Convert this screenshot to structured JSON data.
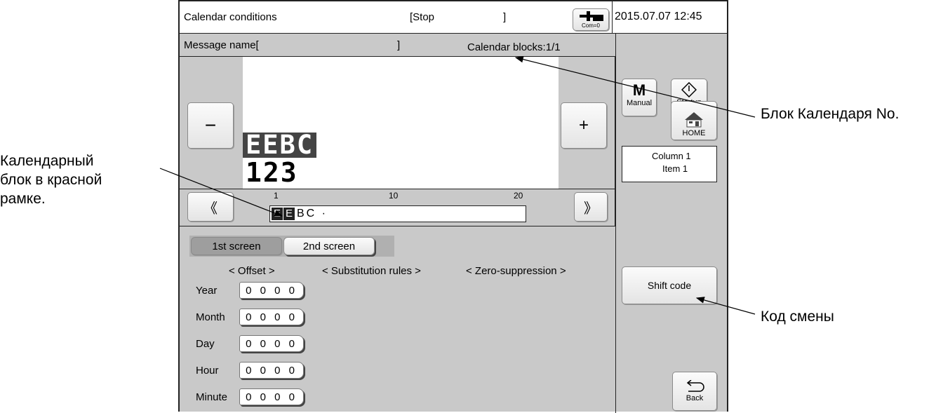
{
  "header": {
    "title": "Calendar conditions",
    "status": "[Stop",
    "status_close": "]",
    "com_label": "Com=0",
    "datetime": "2015.07.07 12:45"
  },
  "subheader": {
    "message_name": "Message name[",
    "message_close": "]",
    "calendar_blocks": "Calendar blocks:1/1"
  },
  "preview": {
    "minus": "−",
    "plus": "+",
    "line1": "EEBC",
    "line2": "123"
  },
  "ruler": {
    "prev": "《",
    "next": "》",
    "tick1": "1",
    "tick10": "10",
    "tick20": "20",
    "content_rest": "BC ·"
  },
  "tabs": {
    "first": "1st screen",
    "second": "2nd screen"
  },
  "columns": {
    "offset": "< Offset >",
    "substitution": "< Substitution rules >",
    "zero": "< Zero-suppression >"
  },
  "rows": [
    {
      "label": "Year",
      "value": "0 0 0 0"
    },
    {
      "label": "Month",
      "value": "0 0 0 0"
    },
    {
      "label": "Day",
      "value": "0 0 0 0"
    },
    {
      "label": "Hour",
      "value": "0 0 0 0"
    },
    {
      "label": "Minute",
      "value": "0 0 0 0"
    }
  ],
  "sidebar": {
    "manual_icon": "M",
    "manual": "Manual",
    "startup": "Startup",
    "home": "HOME",
    "column": "Column 1",
    "item": "Item 1",
    "shift_code": "Shift code",
    "back": "Back"
  },
  "annotations": {
    "block_no": "Блок Календаря No.",
    "red_frame_1": "Календарный",
    "red_frame_2": "блок в красной",
    "red_frame_3": "рамке.",
    "shift": "Код смены"
  },
  "colors": {
    "panel": "#c9c9c9",
    "highlight": "#222222"
  }
}
